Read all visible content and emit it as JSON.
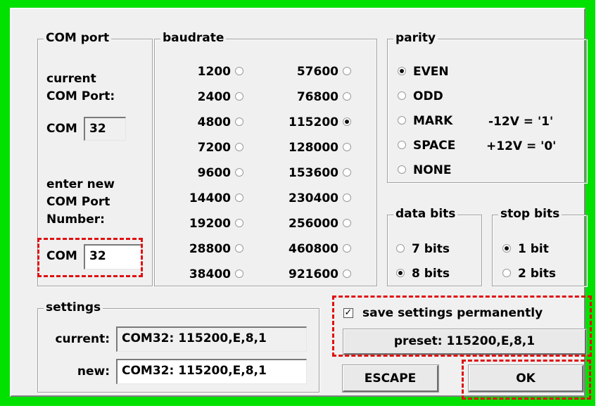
{
  "colors": {
    "frame": "#00e100",
    "highlight": "#e01010",
    "dialog_bg": "#f0f0f0"
  },
  "com_port": {
    "legend": "COM port",
    "current_label_line1": "current",
    "current_label_line2": "COM Port:",
    "com_prefix": "COM",
    "current_value": "32",
    "enter_line1": "enter new",
    "enter_line2": "COM Port",
    "enter_line3": "Number:",
    "new_prefix": "COM",
    "new_value": "32"
  },
  "baudrate": {
    "legend": "baudrate",
    "col1": [
      "1200",
      "2400",
      "4800",
      "7200",
      "9600",
      "14400",
      "19200",
      "28800",
      "38400"
    ],
    "col2": [
      "57600",
      "76800",
      "115200",
      "128000",
      "153600",
      "230400",
      "256000",
      "460800",
      "921600"
    ],
    "selected": "115200"
  },
  "parity": {
    "legend": "parity",
    "options": [
      "EVEN",
      "ODD",
      "MARK",
      "SPACE",
      "NONE"
    ],
    "mark_note": "-12V = '1'",
    "space_note": "+12V = '0'",
    "selected": "EVEN"
  },
  "data_bits": {
    "legend": "data bits",
    "options": [
      "7 bits",
      "8 bits"
    ],
    "selected": "8 bits"
  },
  "stop_bits": {
    "legend": "stop bits",
    "options": [
      "1 bit",
      "2 bits"
    ],
    "selected": "1 bit"
  },
  "settings": {
    "legend": "settings",
    "current_label": "current:",
    "current_value": "COM32: 115200,E,8,1",
    "new_label": "new:",
    "new_value": "COM32: 115200,E,8,1"
  },
  "save": {
    "label": "save settings permanently",
    "checked": true,
    "check_glyph": "✓"
  },
  "preset_button": "preset:  115200,E,8,1",
  "escape_button": "ESCAPE",
  "ok_button": "OK"
}
